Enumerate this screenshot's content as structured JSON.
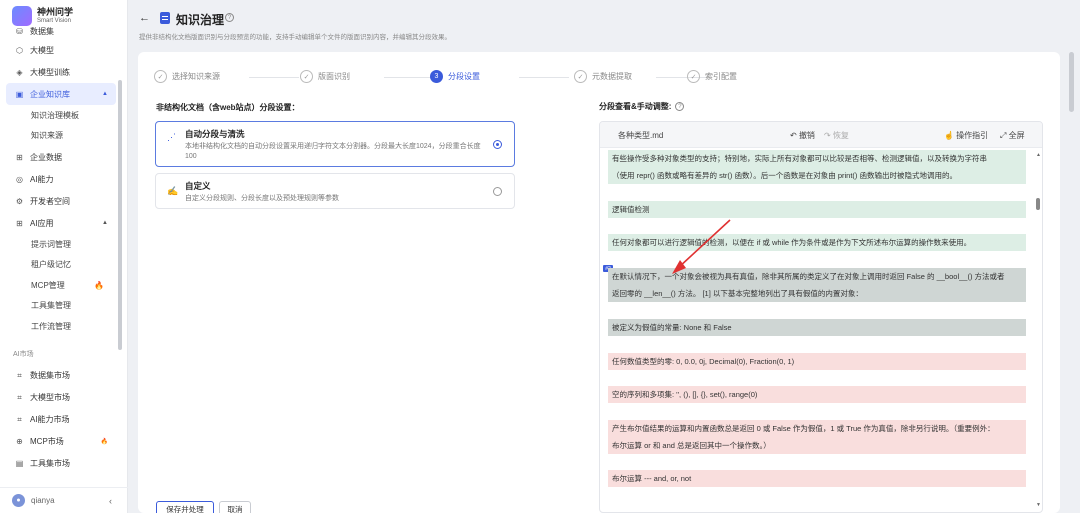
{
  "app": {
    "name": "神州问学",
    "subtitle": "Smart Vision"
  },
  "sidebar": {
    "items": [
      {
        "label": "数据集",
        "icon": "database-icon"
      },
      {
        "label": "大模型",
        "icon": "cube-icon"
      },
      {
        "label": "大模型训练",
        "icon": "training-icon"
      },
      {
        "label": "企业知识库",
        "icon": "book-icon",
        "active": true
      },
      {
        "label": "知识治理模板"
      },
      {
        "label": "知识来源"
      },
      {
        "label": "企业数据",
        "icon": "data-icon"
      },
      {
        "label": "AI能力",
        "icon": "ai-icon"
      },
      {
        "label": "开发者空间",
        "icon": "gear-icon"
      },
      {
        "label": "AI应用",
        "icon": "grid-icon"
      },
      {
        "label": "提示词管理"
      },
      {
        "label": "租户级记忆"
      },
      {
        "label": "MCP管理",
        "hot": "🔥"
      },
      {
        "label": "工具集管理"
      },
      {
        "label": "工作流管理"
      },
      {
        "label": "AI市场"
      },
      {
        "label": "数据集市场",
        "icon": "scan-icon"
      },
      {
        "label": "大模型市场",
        "icon": "scan-icon"
      },
      {
        "label": "AI能力市场",
        "icon": "scan-icon"
      },
      {
        "label": "MCP市场",
        "icon": "mcp-icon",
        "hot": "🔥"
      },
      {
        "label": "工具集市场",
        "icon": "toolbox-icon"
      }
    ],
    "user": "qianya",
    "collapse": "‹"
  },
  "header": {
    "back": "←",
    "title": "知识治理",
    "help": "?",
    "description": "提供非结构化文档版面识别与分段预览的功能，支持手动编辑单个文件的版面识别内容，并编辑其分段效果。"
  },
  "steps": [
    {
      "label": "选择知识来源",
      "mark": "✓"
    },
    {
      "label": "版面识别",
      "mark": "✓"
    },
    {
      "label": "分段设置",
      "mark": "3"
    },
    {
      "label": "元数据提取",
      "mark": "✓"
    },
    {
      "label": "索引配置",
      "mark": "✓"
    }
  ],
  "left": {
    "section_title": "非结构化文档（含web站点）分段设置：",
    "options": [
      {
        "name": "自动分段与清洗",
        "desc": "本地非结构化文档的自动分段设置采用递归字符文本分割器。分段最大长度1024，分段重合长度100",
        "selected": true
      },
      {
        "name": "自定义",
        "desc": "自定义分段规则、分段长度以及预处理规则等参数",
        "selected": false
      }
    ]
  },
  "right": {
    "section_title": "分段查看&手动调整:",
    "help": "?",
    "filename": "各种类型.md",
    "undo": "撤销",
    "redo": "恢复",
    "guide": "操作指引",
    "fullscreen": "全屏",
    "chunk_tag": "#2",
    "lines": [
      "有些操作受多种对象类型的支持；特别地，实际上所有对象都可以比较是否相等、检测逻辑值，以及转换为字符串",
      "（使用 repr() 函数或略有差异的 str() 函数）。后一个函数是在对象由 print() 函数输出时被隐式地调用的。",
      "逻辑值检测",
      "任何对象都可以进行逻辑值的检测，以便在 if 或 while 作为条件或是作为下文所述布尔运算的操作数来使用。",
      "在默认情况下，一个对象会被视为具有真值，除非其所属的类定义了在对象上调用时返回 False 的 __bool__() 方法或者",
      "返回零的 __len__() 方法。 [1] 以下基本完整地列出了具有假值的内置对象：",
      "被定义为假值的常量: None 和 False",
      "任何数值类型的零: 0, 0.0, 0j, Decimal(0), Fraction(0, 1)",
      "空的序列和多项集: '', (), [], {}, set(), range(0)",
      "产生布尔值结果的运算和内置函数总是返回 0 或 False 作为假值，1 或 True 作为真值，除非另行说明。（重要例外：",
      "布尔运算 or 和 and 总是返回其中一个操作数。）",
      "布尔运算 --- and, or, not"
    ]
  },
  "footer": {
    "save": "保存并处理",
    "cancel": "取消"
  },
  "colors": {
    "accent": "#3b5bdb",
    "chunk_green": "#ddeee5",
    "chunk_gray": "#cfd6d4",
    "chunk_red": "#f9dedd",
    "arrow": "#e03131"
  }
}
